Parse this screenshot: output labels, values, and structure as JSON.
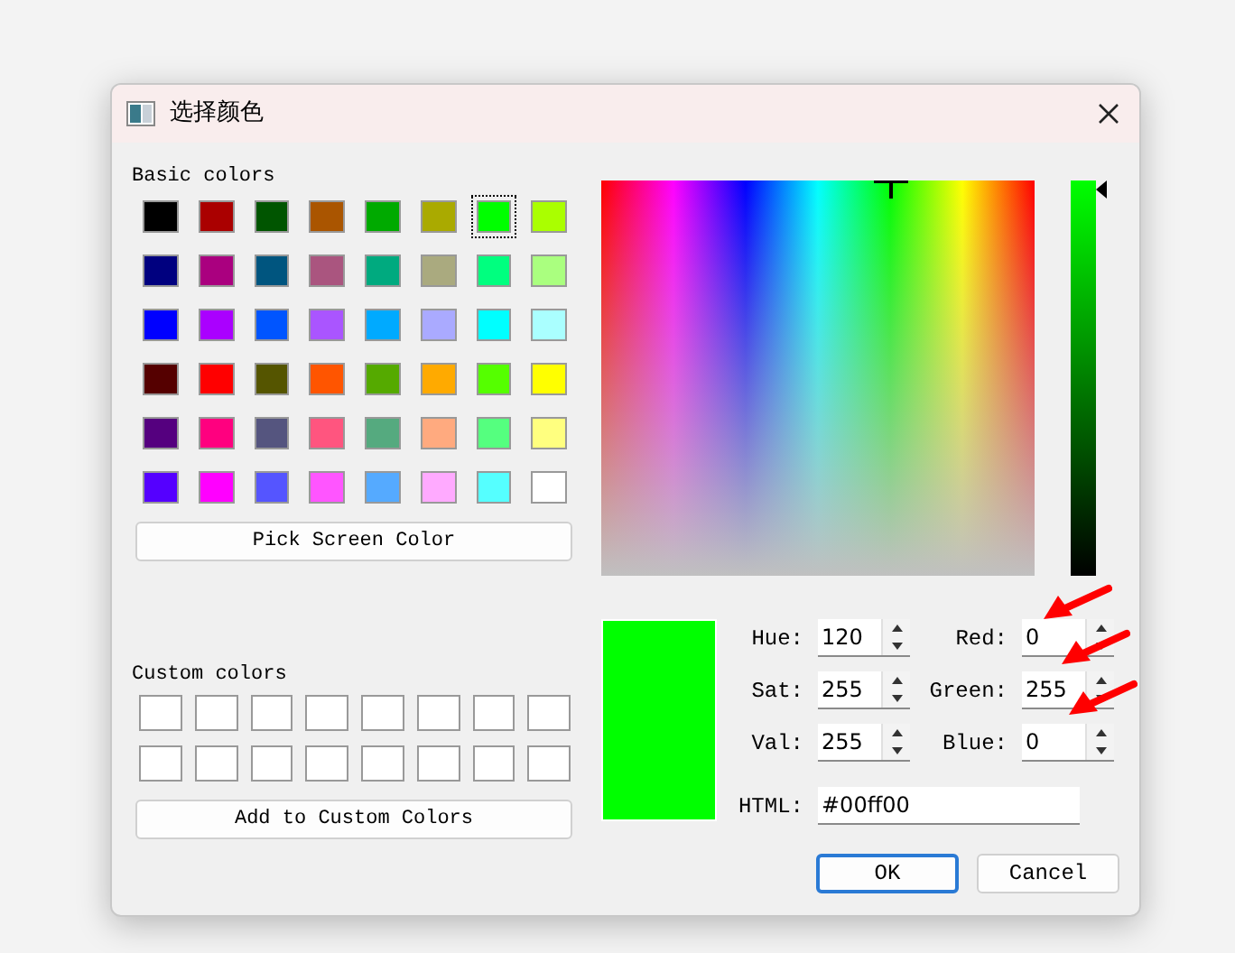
{
  "window": {
    "title": "选择颜色"
  },
  "basic_colors_label": "Basic colors",
  "basic_colors": [
    {
      "color": "#000000",
      "selected": false
    },
    {
      "color": "#aa0000",
      "selected": false
    },
    {
      "color": "#005500",
      "selected": false
    },
    {
      "color": "#aa5500",
      "selected": false
    },
    {
      "color": "#00aa00",
      "selected": false
    },
    {
      "color": "#aaaa00",
      "selected": false
    },
    {
      "color": "#00ff00",
      "selected": true
    },
    {
      "color": "#aaff00",
      "selected": false
    },
    {
      "color": "#00007f",
      "selected": false
    },
    {
      "color": "#aa007f",
      "selected": false
    },
    {
      "color": "#00557f",
      "selected": false
    },
    {
      "color": "#aa557f",
      "selected": false
    },
    {
      "color": "#00aa7f",
      "selected": false
    },
    {
      "color": "#aaaa7f",
      "selected": false
    },
    {
      "color": "#00ff7f",
      "selected": false
    },
    {
      "color": "#aaff7f",
      "selected": false
    },
    {
      "color": "#0000ff",
      "selected": false
    },
    {
      "color": "#aa00ff",
      "selected": false
    },
    {
      "color": "#0055ff",
      "selected": false
    },
    {
      "color": "#aa55ff",
      "selected": false
    },
    {
      "color": "#00aaff",
      "selected": false
    },
    {
      "color": "#aaaaff",
      "selected": false
    },
    {
      "color": "#00ffff",
      "selected": false
    },
    {
      "color": "#aaffff",
      "selected": false
    },
    {
      "color": "#550000",
      "selected": false
    },
    {
      "color": "#ff0000",
      "selected": false
    },
    {
      "color": "#555500",
      "selected": false
    },
    {
      "color": "#ff5500",
      "selected": false
    },
    {
      "color": "#55aa00",
      "selected": false
    },
    {
      "color": "#ffaa00",
      "selected": false
    },
    {
      "color": "#55ff00",
      "selected": false
    },
    {
      "color": "#ffff00",
      "selected": false
    },
    {
      "color": "#55007f",
      "selected": false
    },
    {
      "color": "#ff007f",
      "selected": false
    },
    {
      "color": "#55557f",
      "selected": false
    },
    {
      "color": "#ff557f",
      "selected": false
    },
    {
      "color": "#55aa7f",
      "selected": false
    },
    {
      "color": "#ffaa7f",
      "selected": false
    },
    {
      "color": "#55ff7f",
      "selected": false
    },
    {
      "color": "#ffff7f",
      "selected": false
    },
    {
      "color": "#5500ff",
      "selected": false
    },
    {
      "color": "#ff00ff",
      "selected": false
    },
    {
      "color": "#5555ff",
      "selected": false
    },
    {
      "color": "#ff55ff",
      "selected": false
    },
    {
      "color": "#55aaff",
      "selected": false
    },
    {
      "color": "#ffaaff",
      "selected": false
    },
    {
      "color": "#55ffff",
      "selected": false
    },
    {
      "color": "#ffffff",
      "selected": false
    }
  ],
  "pick_button": "Pick Screen Color",
  "custom_colors_label": "Custom colors",
  "custom_colors": [
    {
      "color": "#ffffff"
    },
    {
      "color": "#ffffff"
    },
    {
      "color": "#ffffff"
    },
    {
      "color": "#ffffff"
    },
    {
      "color": "#ffffff"
    },
    {
      "color": "#ffffff"
    },
    {
      "color": "#ffffff"
    },
    {
      "color": "#ffffff"
    },
    {
      "color": "#ffffff"
    },
    {
      "color": "#ffffff"
    },
    {
      "color": "#ffffff"
    },
    {
      "color": "#ffffff"
    },
    {
      "color": "#ffffff"
    },
    {
      "color": "#ffffff"
    },
    {
      "color": "#ffffff"
    },
    {
      "color": "#ffffff"
    }
  ],
  "add_button": "Add to Custom Colors",
  "value_slider": {
    "level": 1
  },
  "preview": {
    "color": "#00ff00"
  },
  "hsv_fields": [
    {
      "label": "Hue:",
      "value": "120"
    },
    {
      "label": "Sat:",
      "value": "255"
    },
    {
      "label": "Val:",
      "value": "255"
    }
  ],
  "rgb_fields": [
    {
      "label": "Red:",
      "value": "0"
    },
    {
      "label": "Green:",
      "value": "255"
    },
    {
      "label": "Blue:",
      "value": "0"
    }
  ],
  "html_field": {
    "label": "HTML:",
    "value": "#00ff00"
  },
  "buttons": [
    {
      "label": "OK",
      "default": true
    },
    {
      "label": "Cancel",
      "default": false
    }
  ]
}
